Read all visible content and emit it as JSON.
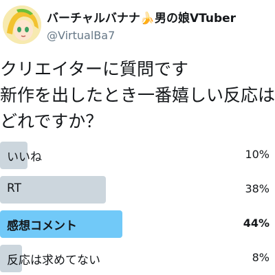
{
  "account": {
    "display_name": "バーチャルバナナ🍌男の娘VTuber",
    "handle": "@VirtualBa7",
    "avatar_icon": "banana-vtuber-avatar"
  },
  "tweet": {
    "text": "クリエイターに質問です\n新作を出したとき一番嬉しい反応は\nどれですか？"
  },
  "poll": {
    "options": [
      {
        "label": "いいね",
        "percent": "10%",
        "fraction": 0.1,
        "winner": false
      },
      {
        "label": "RT",
        "percent": "38%",
        "fraction": 0.38,
        "winner": false
      },
      {
        "label": "感想コメント",
        "percent": "44%",
        "fraction": 0.44,
        "winner": true
      },
      {
        "label": "反応は求めてない",
        "percent": "8%",
        "fraction": 0.08,
        "winner": false
      }
    ],
    "colors": {
      "bar": "#ccd6dd",
      "winner_bar": "#71c9f8"
    }
  }
}
